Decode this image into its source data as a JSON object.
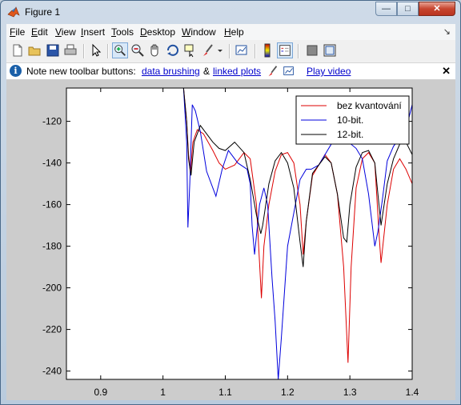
{
  "window": {
    "title": "Figure 1",
    "minimize": "—",
    "maximize": "□",
    "close": "✕"
  },
  "menu": {
    "items": [
      {
        "u": "F",
        "rest": "ile"
      },
      {
        "u": "E",
        "rest": "dit"
      },
      {
        "u": "V",
        "rest": "iew"
      },
      {
        "u": "I",
        "rest": "nsert"
      },
      {
        "u": "T",
        "rest": "ools"
      },
      {
        "u": "D",
        "rest": "esktop"
      },
      {
        "u": "W",
        "rest": "indow"
      },
      {
        "u": "H",
        "rest": "elp"
      }
    ],
    "end_glyph": "↘"
  },
  "toolbar": {
    "icons": [
      "new-figure-icon",
      "open-file-icon",
      "save-icon",
      "print-icon",
      "pointer-icon",
      "zoom-in-icon",
      "zoom-out-icon",
      "pan-icon",
      "rotate-3d-icon",
      "data-cursor-icon",
      "brush-icon",
      "brush-dropdown-icon",
      "link-plot-icon",
      "colorbar-icon",
      "legend-icon",
      "hide-plot-tools-icon",
      "show-plot-tools-icon"
    ]
  },
  "infobar": {
    "text": "Note new toolbar buttons:",
    "link1": "data brushing",
    "amp": "&",
    "link2": "linked plots",
    "link3": "Play video",
    "close": "✕"
  },
  "chart_data": {
    "type": "line",
    "xlim": [
      0.845,
      1.4
    ],
    "ylim": [
      -244,
      -104
    ],
    "xticks": [
      "0.9",
      "1",
      "1.1",
      "1.2",
      "1.3",
      "1.4"
    ],
    "yticks": [
      "-120",
      "-140",
      "-160",
      "-180",
      "-200",
      "-220",
      "-240"
    ],
    "grid": false,
    "legend_position": "top-right",
    "colors": {
      "red": "#dd0000",
      "blue": "#0000dd",
      "black": "#000000"
    },
    "series": [
      {
        "name": "bez kvantování",
        "color": "#dd0000",
        "x": [
          1.0,
          1.02,
          1.033,
          1.038,
          1.041,
          1.044,
          1.048,
          1.055,
          1.065,
          1.08,
          1.09,
          1.1,
          1.115,
          1.13,
          1.14,
          1.15,
          1.155,
          1.158,
          1.162,
          1.17,
          1.18,
          1.19,
          1.2,
          1.21,
          1.22,
          1.225,
          1.23,
          1.24,
          1.26,
          1.27,
          1.28,
          1.29,
          1.297,
          1.302,
          1.31,
          1.32,
          1.33,
          1.34,
          1.347,
          1.35,
          1.36,
          1.37,
          1.38,
          1.39,
          1.4
        ],
        "y": [
          -70,
          -90,
          -104,
          -120,
          -136,
          -145,
          -130,
          -124,
          -126,
          -134,
          -140,
          -143,
          -141,
          -135,
          -138,
          -160,
          -188,
          -205,
          -180,
          -160,
          -144,
          -136,
          -135,
          -140,
          -160,
          -184,
          -168,
          -146,
          -136,
          -140,
          -155,
          -190,
          -236,
          -190,
          -152,
          -138,
          -135,
          -140,
          -175,
          -188,
          -160,
          -143,
          -138,
          -143,
          -150
        ]
      },
      {
        "name": "10-bit.",
        "color": "#0000dd",
        "x": [
          1.0,
          1.025,
          1.033,
          1.038,
          1.04,
          1.043,
          1.047,
          1.052,
          1.06,
          1.07,
          1.08,
          1.085,
          1.095,
          1.105,
          1.12,
          1.135,
          1.14,
          1.143,
          1.147,
          1.15,
          1.155,
          1.162,
          1.168,
          1.175,
          1.18,
          1.185,
          1.19,
          1.2,
          1.22,
          1.23,
          1.238,
          1.25,
          1.26,
          1.27,
          1.285,
          1.297,
          1.302,
          1.31,
          1.32,
          1.33,
          1.34,
          1.345,
          1.352,
          1.36,
          1.37,
          1.38,
          1.39,
          1.4
        ],
        "y": [
          -60,
          -85,
          -104,
          -130,
          -171,
          -150,
          -112,
          -115,
          -125,
          -144,
          -152,
          -156,
          -143,
          -134,
          -140,
          -143,
          -150,
          -170,
          -184,
          -175,
          -160,
          -152,
          -160,
          -195,
          -216,
          -244,
          -224,
          -180,
          -148,
          -143,
          -143,
          -141,
          -136,
          -131,
          -125,
          -129,
          -131,
          -133,
          -138,
          -155,
          -180,
          -173,
          -158,
          -139,
          -132,
          -128,
          -124,
          -112
        ]
      },
      {
        "name": "12-bit.",
        "color": "#000000",
        "x": [
          1.0,
          1.025,
          1.033,
          1.038,
          1.041,
          1.045,
          1.05,
          1.06,
          1.07,
          1.08,
          1.09,
          1.1,
          1.115,
          1.13,
          1.14,
          1.15,
          1.157,
          1.16,
          1.17,
          1.18,
          1.19,
          1.2,
          1.21,
          1.22,
          1.225,
          1.23,
          1.24,
          1.26,
          1.27,
          1.28,
          1.29,
          1.295,
          1.3,
          1.31,
          1.32,
          1.33,
          1.34,
          1.35,
          1.36,
          1.37,
          1.38,
          1.39,
          1.4
        ],
        "y": [
          -65,
          -90,
          -104,
          -120,
          -138,
          -146,
          -130,
          -122,
          -126,
          -130,
          -133,
          -134,
          -130,
          -135,
          -148,
          -165,
          -174,
          -170,
          -150,
          -139,
          -135,
          -140,
          -152,
          -178,
          -190,
          -168,
          -145,
          -137,
          -140,
          -155,
          -176,
          -178,
          -160,
          -142,
          -135,
          -134,
          -140,
          -170,
          -150,
          -138,
          -131,
          -130,
          -136
        ]
      }
    ]
  }
}
